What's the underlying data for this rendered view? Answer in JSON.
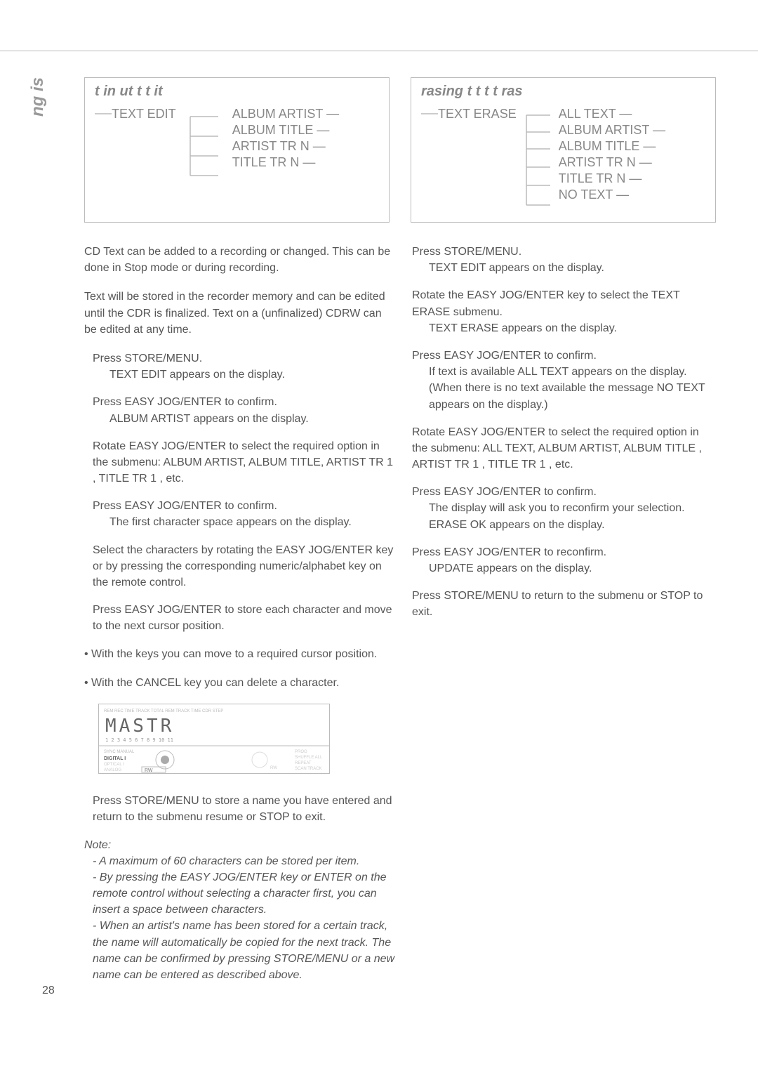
{
  "sideTab": "ng is",
  "pageNumber": "28",
  "diagramLeft": {
    "title": "t in ut t   t     it",
    "root": "TEXT EDIT",
    "items": [
      "ALBUM ARTIST",
      "ALBUM TITLE",
      "ARTIST TR N",
      "TITLE TR N"
    ]
  },
  "diagramRight": {
    "title": "rasing t   t t   t   ras",
    "root": "TEXT ERASE",
    "items": [
      "ALL TEXT",
      "ALBUM ARTIST",
      "ALBUM TITLE",
      "ARTIST TR N",
      "TITLE TR N",
      "NO TEXT"
    ]
  },
  "left": {
    "p1": "CD Text can be added to a recording or changed. This can be done in Stop mode or during recording.",
    "p2": "Text will be stored in the recorder memory and can be edited until the CDR is finalized. Text on a (unfinalized) CDRW can be edited at any time.",
    "s1a": "Press STORE/MENU.",
    "s1b": "TEXT EDIT appears on the display.",
    "s2a": "Press EASY JOG/ENTER to confirm.",
    "s2b": "ALBUM ARTIST appears on the display.",
    "s3": "Rotate EASY JOG/ENTER to select the required option in the submenu: ALBUM ARTIST, ALBUM TITLE, ARTIST TR 1 , TITLE TR 1 , etc.",
    "s4a": "Press EASY JOG/ENTER to confirm.",
    "s4b": "The first character space appears on the display.",
    "s5": "Select the characters by rotating the EASY JOG/ENTER key or by pressing the corresponding numeric/alphabet key on the remote control.",
    "s6": "Press EASY JOG/ENTER to store each character and move to the next cursor position.",
    "b1": "• With the         keys you can move to a required cursor position.",
    "b2": "• With the CANCEL key you can delete a character.",
    "s7": "Press STORE/MENU to store a name you have entered and return to the submenu resume or STOP to exit.",
    "noteLabel": "Note:",
    "n1": "- A maximum of 60 characters can be stored per item.",
    "n2": "- By pressing the EASY JOG/ENTER key or ENTER on the remote control without selecting a character first, you can insert a space between characters.",
    "n3": "- When an artist's name has been stored for a certain track, the name will automatically be copied for the next track. The name can be confirmed by pressing STORE/MENU or a new name can be entered as described above."
  },
  "right": {
    "s1a": "Press STORE/MENU.",
    "s1b": "TEXT EDIT appears on the display.",
    "s2a": "Rotate the EASY JOG/ENTER key to select the TEXT ERASE submenu.",
    "s2b": "TEXT ERASE appears on the display.",
    "s3a": "Press EASY JOG/ENTER to confirm.",
    "s3b": "If text is available ALL TEXT appears on the display. (When there is no text available the message NO TEXT appears on the display.)",
    "s4": "Rotate EASY JOG/ENTER to select the required option in the submenu: ALL TEXT, ALBUM ARTIST, ALBUM TITLE , ARTIST TR 1 , TITLE TR 1 , etc.",
    "s5a": "Press EASY JOG/ENTER to confirm.",
    "s5b": "The display will ask you to reconfirm your selection. ERASE OK appears on the display.",
    "s6a": "Press EASY JOG/ENTER to reconfirm.",
    "s6b": "UPDATE appears on the display.",
    "s7": "Press STORE/MENU to return to the submenu or STOP to exit."
  },
  "lcd": {
    "topLabels": "REM   REC   TIME  TRACK          TOTAL  REM   TRACK  TIME             CDR    STEP",
    "main": "MASTR",
    "tracks": "1  2  3  4  5  6  7  8  9 10 11",
    "left1": "SYNC  MANUAL",
    "left2": "DIGITAL I",
    "left3": "OPTICAL I",
    "left4": "ANALOG",
    "rw": "RW",
    "right1": "PROG",
    "right2": "SHUFFLE    ALL",
    "right3": "REPEAT",
    "right4": "SCAN     TRACK"
  }
}
